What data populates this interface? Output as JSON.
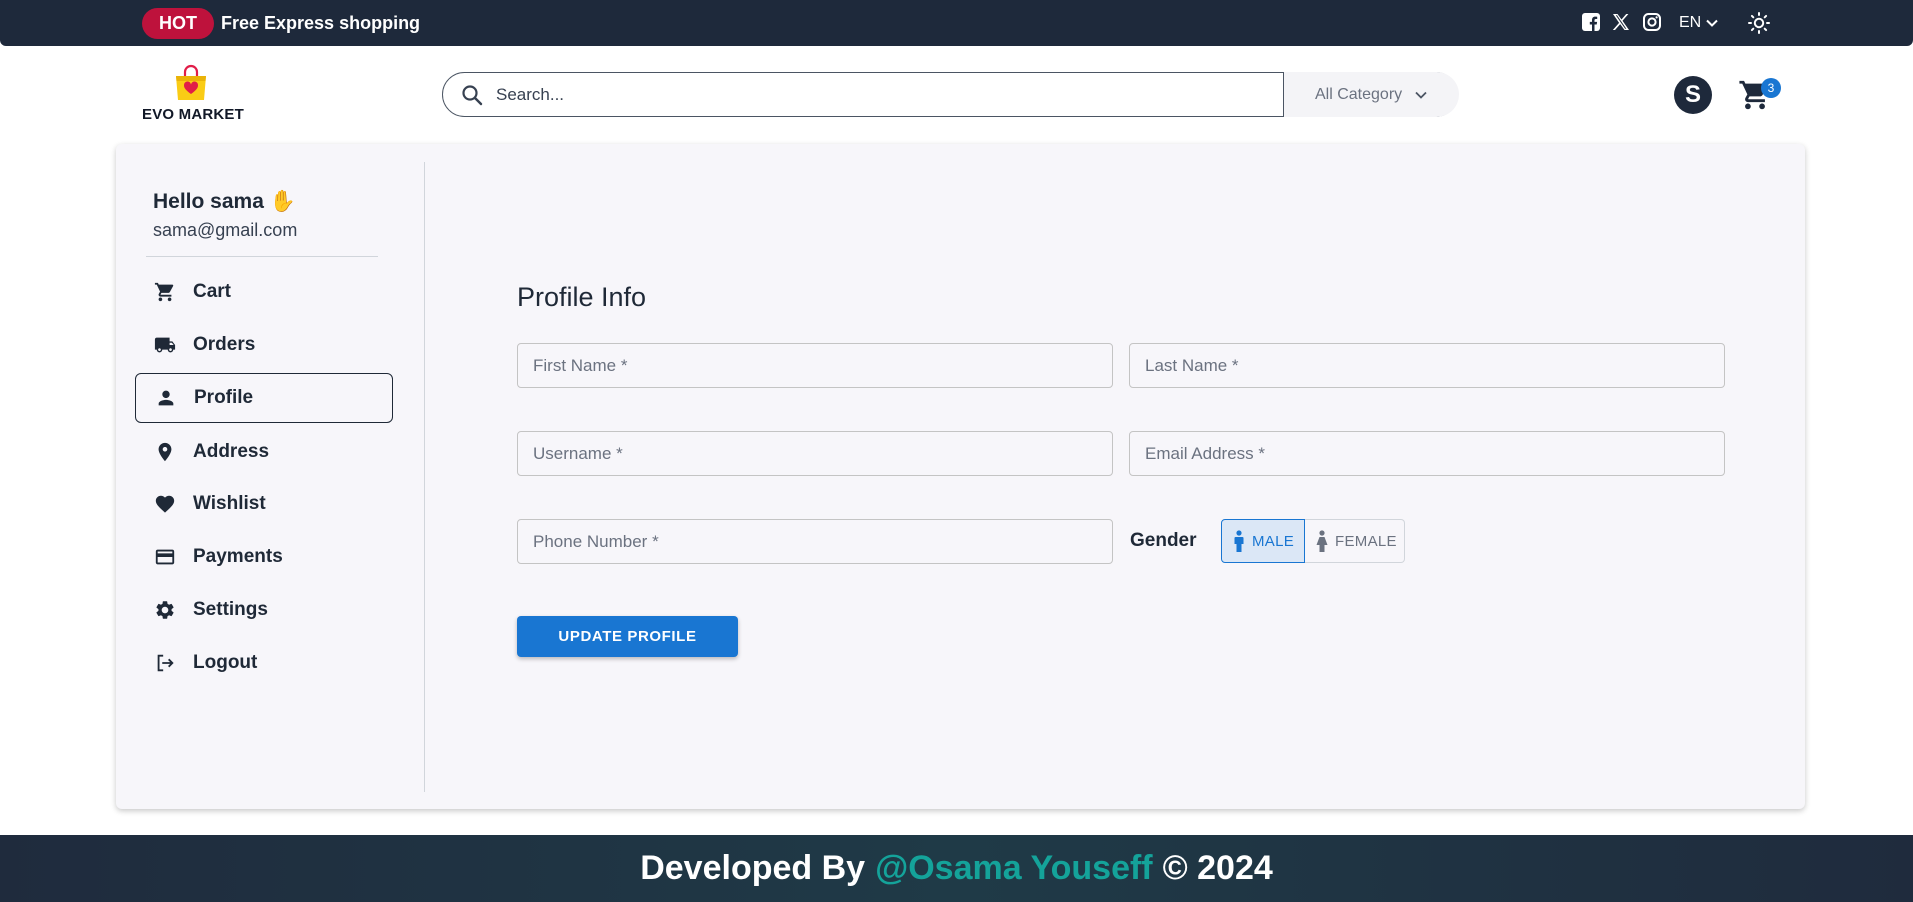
{
  "topbar": {
    "hot_badge": "HOT",
    "promo_text": "Free Express shopping",
    "social_icons": [
      "facebook-icon",
      "x-twitter-icon",
      "instagram-icon"
    ],
    "language": "EN"
  },
  "header": {
    "logo_text": "EVO MARKET",
    "search_placeholder": "Search...",
    "category_selected": "All Category",
    "avatar_initial": "S",
    "cart_count": "3"
  },
  "sidebar": {
    "greeting": "Hello sama ✋",
    "email": "sama@gmail.com",
    "items": [
      {
        "label": "Cart",
        "icon": "cart-icon"
      },
      {
        "label": "Orders",
        "icon": "truck-icon"
      },
      {
        "label": "Profile",
        "icon": "person-icon",
        "active": true
      },
      {
        "label": "Address",
        "icon": "location-pin-icon"
      },
      {
        "label": "Wishlist",
        "icon": "heart-icon"
      },
      {
        "label": "Payments",
        "icon": "credit-card-icon"
      },
      {
        "label": "Settings",
        "icon": "gear-icon"
      },
      {
        "label": "Logout",
        "icon": "logout-icon"
      }
    ]
  },
  "profile": {
    "title": "Profile Info",
    "fields": {
      "first_name": "First Name *",
      "last_name": "Last Name *",
      "username": "Username *",
      "email": "Email Address *",
      "phone": "Phone Number *"
    },
    "gender_label": "Gender",
    "gender_options": [
      "MALE",
      "FEMALE"
    ],
    "gender_selected": "MALE",
    "update_button": "UPDATE PROFILE"
  },
  "footer": {
    "prefix": "Developed By",
    "author": "@Osama Youseff",
    "suffix": "© 2024"
  },
  "colors": {
    "topbar_bg": "#1e293b",
    "hot_badge": "#be123c",
    "primary": "#1976d2",
    "footer_author": "#14a39a",
    "panel_bg": "#f7f6fa"
  }
}
